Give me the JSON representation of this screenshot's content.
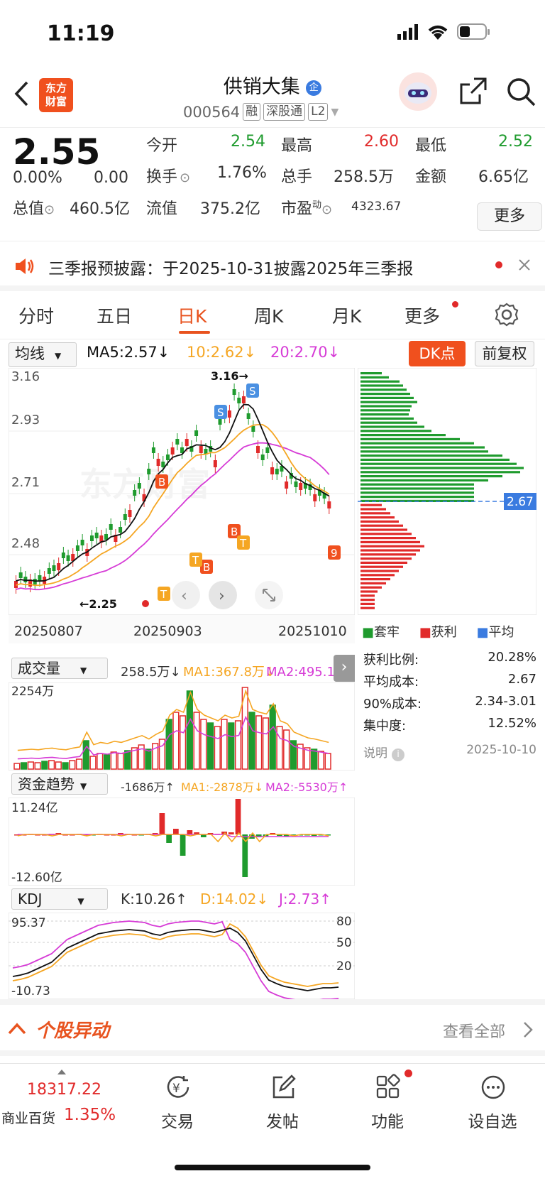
{
  "status_bar": {
    "time": "11:19"
  },
  "header": {
    "logo_line1": "东方",
    "logo_line2": "财富",
    "title": "供销大集",
    "title_badge": "企",
    "code": "000564",
    "tags": [
      "融",
      "深股通",
      "L2"
    ]
  },
  "quote": {
    "price": "2.55",
    "change_pct": "0.00%",
    "change": "0.00",
    "open_label": "今开",
    "open": "2.54",
    "high_label": "最高",
    "high": "2.60",
    "low_label": "最低",
    "low": "2.52",
    "turnover_label": "换手",
    "turnover": "1.76%",
    "volume_label": "总手",
    "volume": "258.5万",
    "amount_label": "金额",
    "amount": "6.65亿",
    "mcap_label": "总值",
    "mcap": "460.5亿",
    "float_label": "流值",
    "float": "375.2亿",
    "pe_label": "市盈",
    "pe_sup": "动",
    "pe": "4323.67",
    "more": "更多"
  },
  "notice": {
    "text": "三季报预披露：于2025-10-31披露2025年三季报"
  },
  "tabs": [
    "分时",
    "五日",
    "日K",
    "周K",
    "月K",
    "更多"
  ],
  "active_tab": "日K",
  "kline": {
    "indicator": "均线",
    "ma5": "MA5:2.57↓",
    "ma10": "10:2.62↓",
    "ma20": "20:2.70↓",
    "dk_btn": "DK点",
    "adjust_btn": "前复权",
    "y_labels": [
      "3.16",
      "2.93",
      "2.71",
      "2.48"
    ],
    "high_mark": "3.16→",
    "low_mark": "←2.25",
    "dates": [
      "20250807",
      "20250903",
      "20251010"
    ],
    "watermark": "东方财富"
  },
  "chip": {
    "avg_label": "2.67",
    "legend": [
      "套牢",
      "获利",
      "平均"
    ],
    "rows": [
      {
        "label": "获利比例:",
        "value": "20.28%"
      },
      {
        "label": "平均成本:",
        "value": "2.67"
      },
      {
        "label": "90%成本:",
        "value": "2.34-3.01"
      },
      {
        "label": "集中度:",
        "value": "12.52%"
      }
    ],
    "note_label": "说明",
    "note_date": "2025-10-10"
  },
  "volume": {
    "indicator": "成交量",
    "v": "258.5万↓",
    "ma1": "MA1:367.8万↓",
    "ma2": "MA2:495.1万",
    "ymax": "2254万"
  },
  "fund": {
    "indicator": "资金趋势",
    "v": "-1686万↑",
    "ma1": "MA1:-2878万↓",
    "ma2": "MA2:-5530万↑",
    "ymax": "11.24亿",
    "ymin": "-12.60亿"
  },
  "kdj": {
    "indicator": "KDJ",
    "k": "K:10.26↑",
    "d": "D:14.02↓",
    "j": "J:2.73↑",
    "ymax": "95.37",
    "ymin": "-10.73",
    "levels": [
      "80",
      "50",
      "20"
    ]
  },
  "section": {
    "title": "个股异动",
    "link": "查看全部"
  },
  "bottom_nav": {
    "index_value": "18317.22",
    "index_name": "商业百货",
    "index_pct": "1.35%",
    "items": [
      "交易",
      "发帖",
      "功能",
      "设自选"
    ]
  },
  "colors": {
    "up": "#e12a2a",
    "down": "#1f9b2e",
    "accent": "#e8531f",
    "ma5": "#111111",
    "ma10": "#f5a623",
    "ma20": "#d63bd6"
  }
}
